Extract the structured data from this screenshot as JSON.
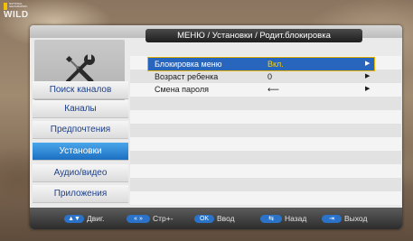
{
  "channel_logo": {
    "brand": "NATIONAL GEOGRAPHIC",
    "name": "WILD"
  },
  "header": {
    "title": "МЕНЮ / Установки / Родит.блокировка"
  },
  "sidebar": {
    "items": [
      {
        "label": "Поиск каналов",
        "active": false
      },
      {
        "label": "Каналы",
        "active": false
      },
      {
        "label": "Предпочтения",
        "active": false
      },
      {
        "label": "Установки",
        "active": true
      },
      {
        "label": "Аудио/видео",
        "active": false
      },
      {
        "label": "Приложения",
        "active": false
      }
    ]
  },
  "settings": {
    "rows": [
      {
        "label": "Блокировка меню",
        "value": "Вкл.",
        "selected": true
      },
      {
        "label": "Возраст ребенка",
        "value": "0",
        "selected": false
      },
      {
        "label": "Смена пароля",
        "value": "⟵",
        "selected": false
      }
    ]
  },
  "footer": {
    "hints": [
      {
        "key": "▲▼",
        "label": "Двиг."
      },
      {
        "key": "«  »",
        "label": "Стр+-"
      },
      {
        "key": "OK",
        "label": "Ввод"
      },
      {
        "key": "⇆",
        "label": "Назад"
      },
      {
        "key": "⇥",
        "label": "Выход"
      }
    ]
  },
  "colors": {
    "accent": "#1c6fc1",
    "selected_row": "#2866bd",
    "selected_value": "#ffd000",
    "sidebar_text": "#1c3f8a"
  }
}
